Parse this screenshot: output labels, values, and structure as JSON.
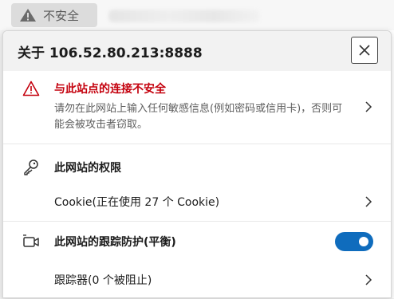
{
  "addressbar": {
    "not_secure_label": "不安全"
  },
  "popup": {
    "title": "关于 106.52.80.213:8888",
    "connection": {
      "title": "与此站点的连接不安全",
      "description": "请勿在此网站上输入任何敏感信息(例如密码或信用卡)，否则可能会被攻击者窃取。"
    },
    "permissions": {
      "title": "此网站的权限",
      "cookie_label": "Cookie(正在使用 27 个 Cookie)"
    },
    "tracking": {
      "title": "此网站的跟踪防护(平衡)",
      "toggle_on": true,
      "trackers_label": "跟踪器(0 个被阻止)"
    }
  },
  "colors": {
    "warning_red": "#c4000d",
    "toggle_blue": "#0f6cbd"
  },
  "icons": [
    "warning-triangle-icon",
    "close-icon",
    "chevron-right-icon",
    "key-icon",
    "camera-tracking-icon"
  ]
}
